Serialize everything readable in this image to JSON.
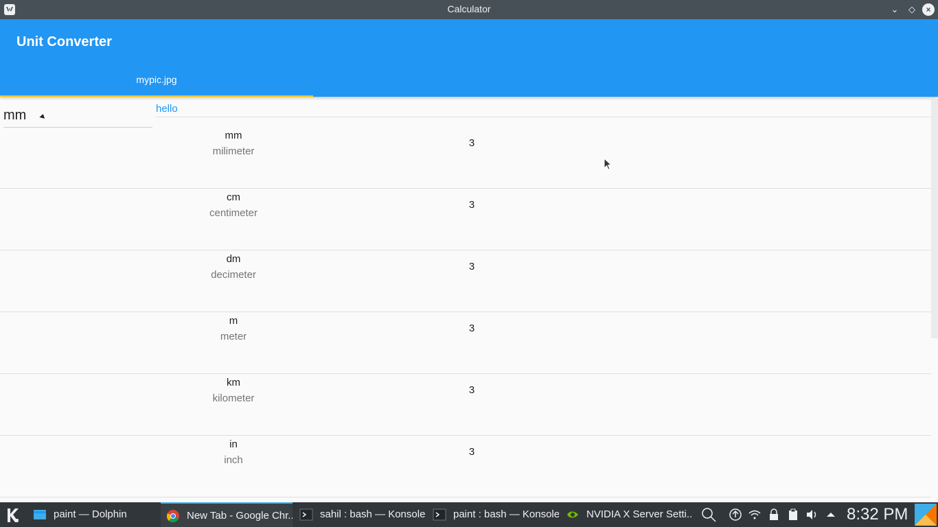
{
  "window": {
    "title": "Calculator",
    "controls": {
      "minimize": "⌄",
      "maximize": "◇",
      "close": "×"
    }
  },
  "appbar": {
    "title": "Unit Converter",
    "tabs": [
      {
        "label": "mypic.jpg",
        "selected": true
      }
    ],
    "color": "#2196f3",
    "indicator_color": "#f6c515"
  },
  "unit_select": {
    "value": "mm"
  },
  "hello_label": "hello",
  "units": [
    {
      "abbr": "mm",
      "name": "milimeter",
      "value": "3"
    },
    {
      "abbr": "cm",
      "name": "centimeter",
      "value": "3"
    },
    {
      "abbr": "dm",
      "name": "decimeter",
      "value": "3"
    },
    {
      "abbr": "m",
      "name": "meter",
      "value": "3"
    },
    {
      "abbr": "km",
      "name": "kilometer",
      "value": "3"
    },
    {
      "abbr": "in",
      "name": "inch",
      "value": "3"
    }
  ],
  "taskbar": {
    "tasks": [
      {
        "label": "paint — Dolphin",
        "icon": "folder-icon",
        "active": false
      },
      {
        "label": "New Tab - Google Chr...",
        "icon": "chrome-icon",
        "active": true
      },
      {
        "label": "sahil : bash — Konsole",
        "icon": "terminal-icon",
        "active": false
      },
      {
        "label": "paint : bash — Konsole",
        "icon": "terminal-icon",
        "active": false
      },
      {
        "label": "NVIDIA X Server Setti...",
        "icon": "nvidia-icon",
        "active": false
      }
    ],
    "tray_icons": [
      "search-icon",
      "updates-icon",
      "wifi-icon",
      "lock-icon",
      "clipboard-icon",
      "volume-icon",
      "expand-tray-icon"
    ],
    "clock": "8:32 PM"
  }
}
